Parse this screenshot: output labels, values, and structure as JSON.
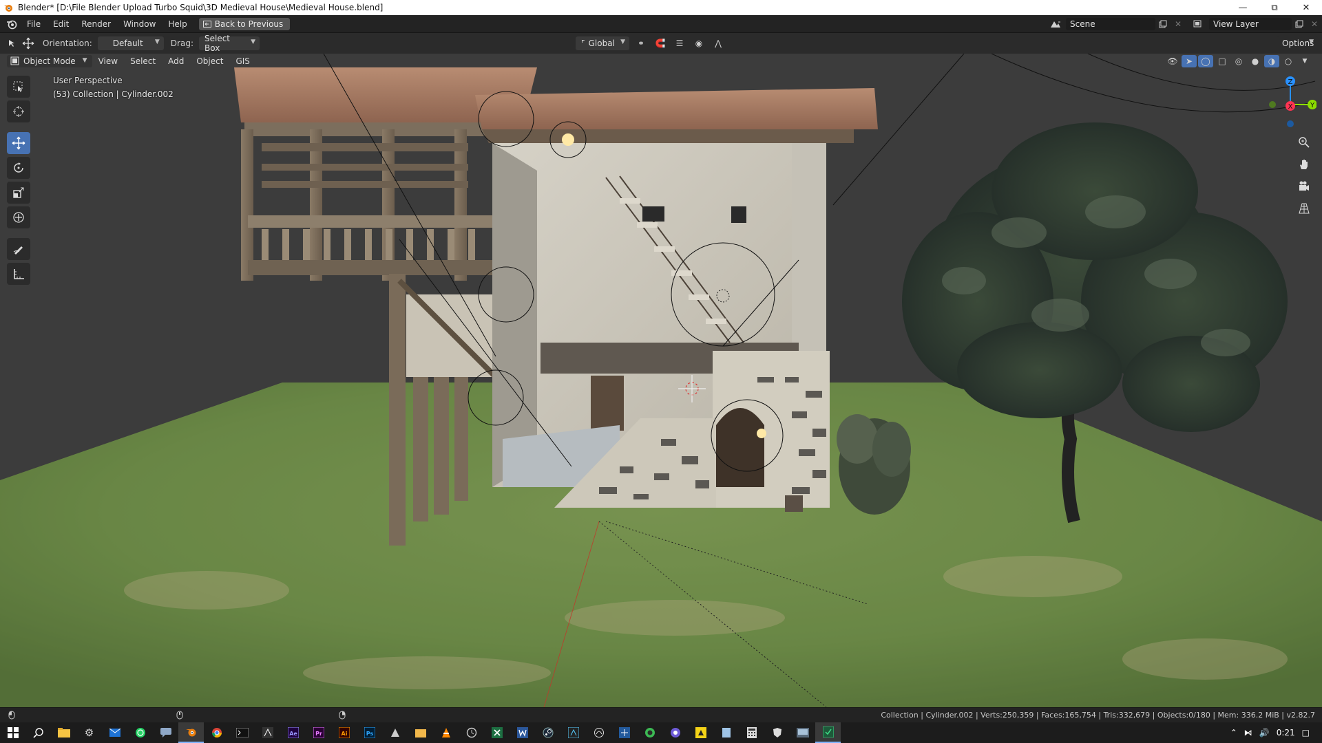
{
  "window": {
    "title": "Blender* [D:\\File Blender Upload Turbo Squid\\3D Medieval House\\Medieval House.blend]",
    "controls": [
      "minimize-icon",
      "restore-icon",
      "close-icon"
    ]
  },
  "menubar": {
    "items": [
      "File",
      "Edit",
      "Render",
      "Window",
      "Help"
    ],
    "back_button": "Back to Previous",
    "scene_field": "Scene",
    "view_layer_field": "View Layer"
  },
  "tool_header": {
    "orientation_label": "Orientation:",
    "orientation_value": "Default",
    "drag_label": "Drag:",
    "drag_value": "Select Box",
    "transform_orientation": "Global",
    "options_label": "Options"
  },
  "viewport_header": {
    "mode": "Object Mode",
    "menus": [
      "View",
      "Select",
      "Add",
      "Object",
      "GIS"
    ]
  },
  "viewport": {
    "perspective_label": "User Perspective",
    "collection_label": "(53) Collection | Cylinder.002",
    "gizmo_axes": {
      "x": "X",
      "y": "Y",
      "z": "Z"
    }
  },
  "toolbar": {
    "tools": [
      "select-box-icon",
      "cursor-icon",
      "move-icon",
      "rotate-icon",
      "scale-icon",
      "transform-icon",
      "annotate-icon",
      "measure-icon"
    ],
    "active": "move-icon"
  },
  "statusbar": {
    "stats": "Collection | Cylinder.002 | Verts:250,359 | Faces:165,754 | Tris:332,679 | Objects:0/180 | Mem: 336.2 MiB | v2.82.7"
  },
  "taskbar": {
    "apps": [
      "windows-start-icon",
      "search-icon",
      "file-explorer-icon",
      "settings-icon",
      "mail-icon",
      "whatsapp-icon",
      "chat-icon",
      "blender-icon",
      "chrome-icon",
      "terminal-icon",
      "app-icon",
      "after-effects-icon",
      "premiere-icon",
      "illustrator-icon",
      "photoshop-icon",
      "app-icon",
      "folder-icon",
      "vlc-icon",
      "app-icon",
      "excel-icon",
      "word-icon",
      "steam-icon",
      "app-icon",
      "app-icon",
      "app-icon",
      "app-icon",
      "app-icon",
      "app-icon",
      "app-icon",
      "calculator-icon",
      "shield-icon",
      "app-icon",
      "app-icon"
    ],
    "clock": "0:21"
  },
  "colors": {
    "accent_blue": "#4772b3",
    "axis_x": "#ff3352",
    "axis_y": "#8bdc00",
    "axis_z": "#2890ff"
  }
}
